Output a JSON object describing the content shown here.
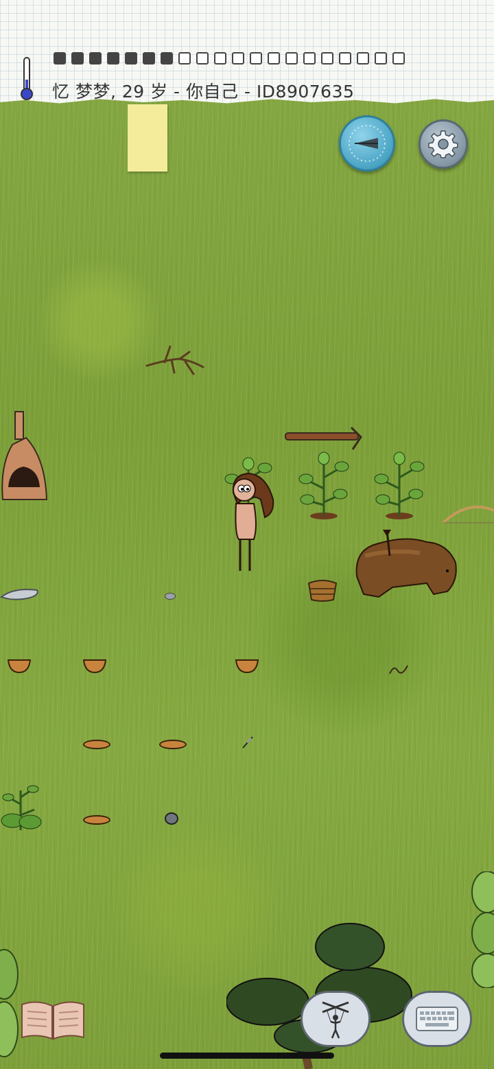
{
  "header": {
    "title": "忆 梦梦, 29 岁 - 你自己 - ID8907635",
    "hunger_boxes": {
      "filled": 7,
      "total": 20
    }
  },
  "buttons": {
    "home_compass_icon": "compass-arrow-icon",
    "settings_icon": "gear-icon",
    "tech_book_icon": "open-book-icon",
    "emote_icon": "puppet-icon",
    "keyboard_icon": "keyboard-icon"
  },
  "colors": {
    "grass": "#7fa23a",
    "paper": "#f7f8f4",
    "sticky_note": "#f4ec9a",
    "compass": "#5fb3d0",
    "settings": "#8fa0ad"
  }
}
